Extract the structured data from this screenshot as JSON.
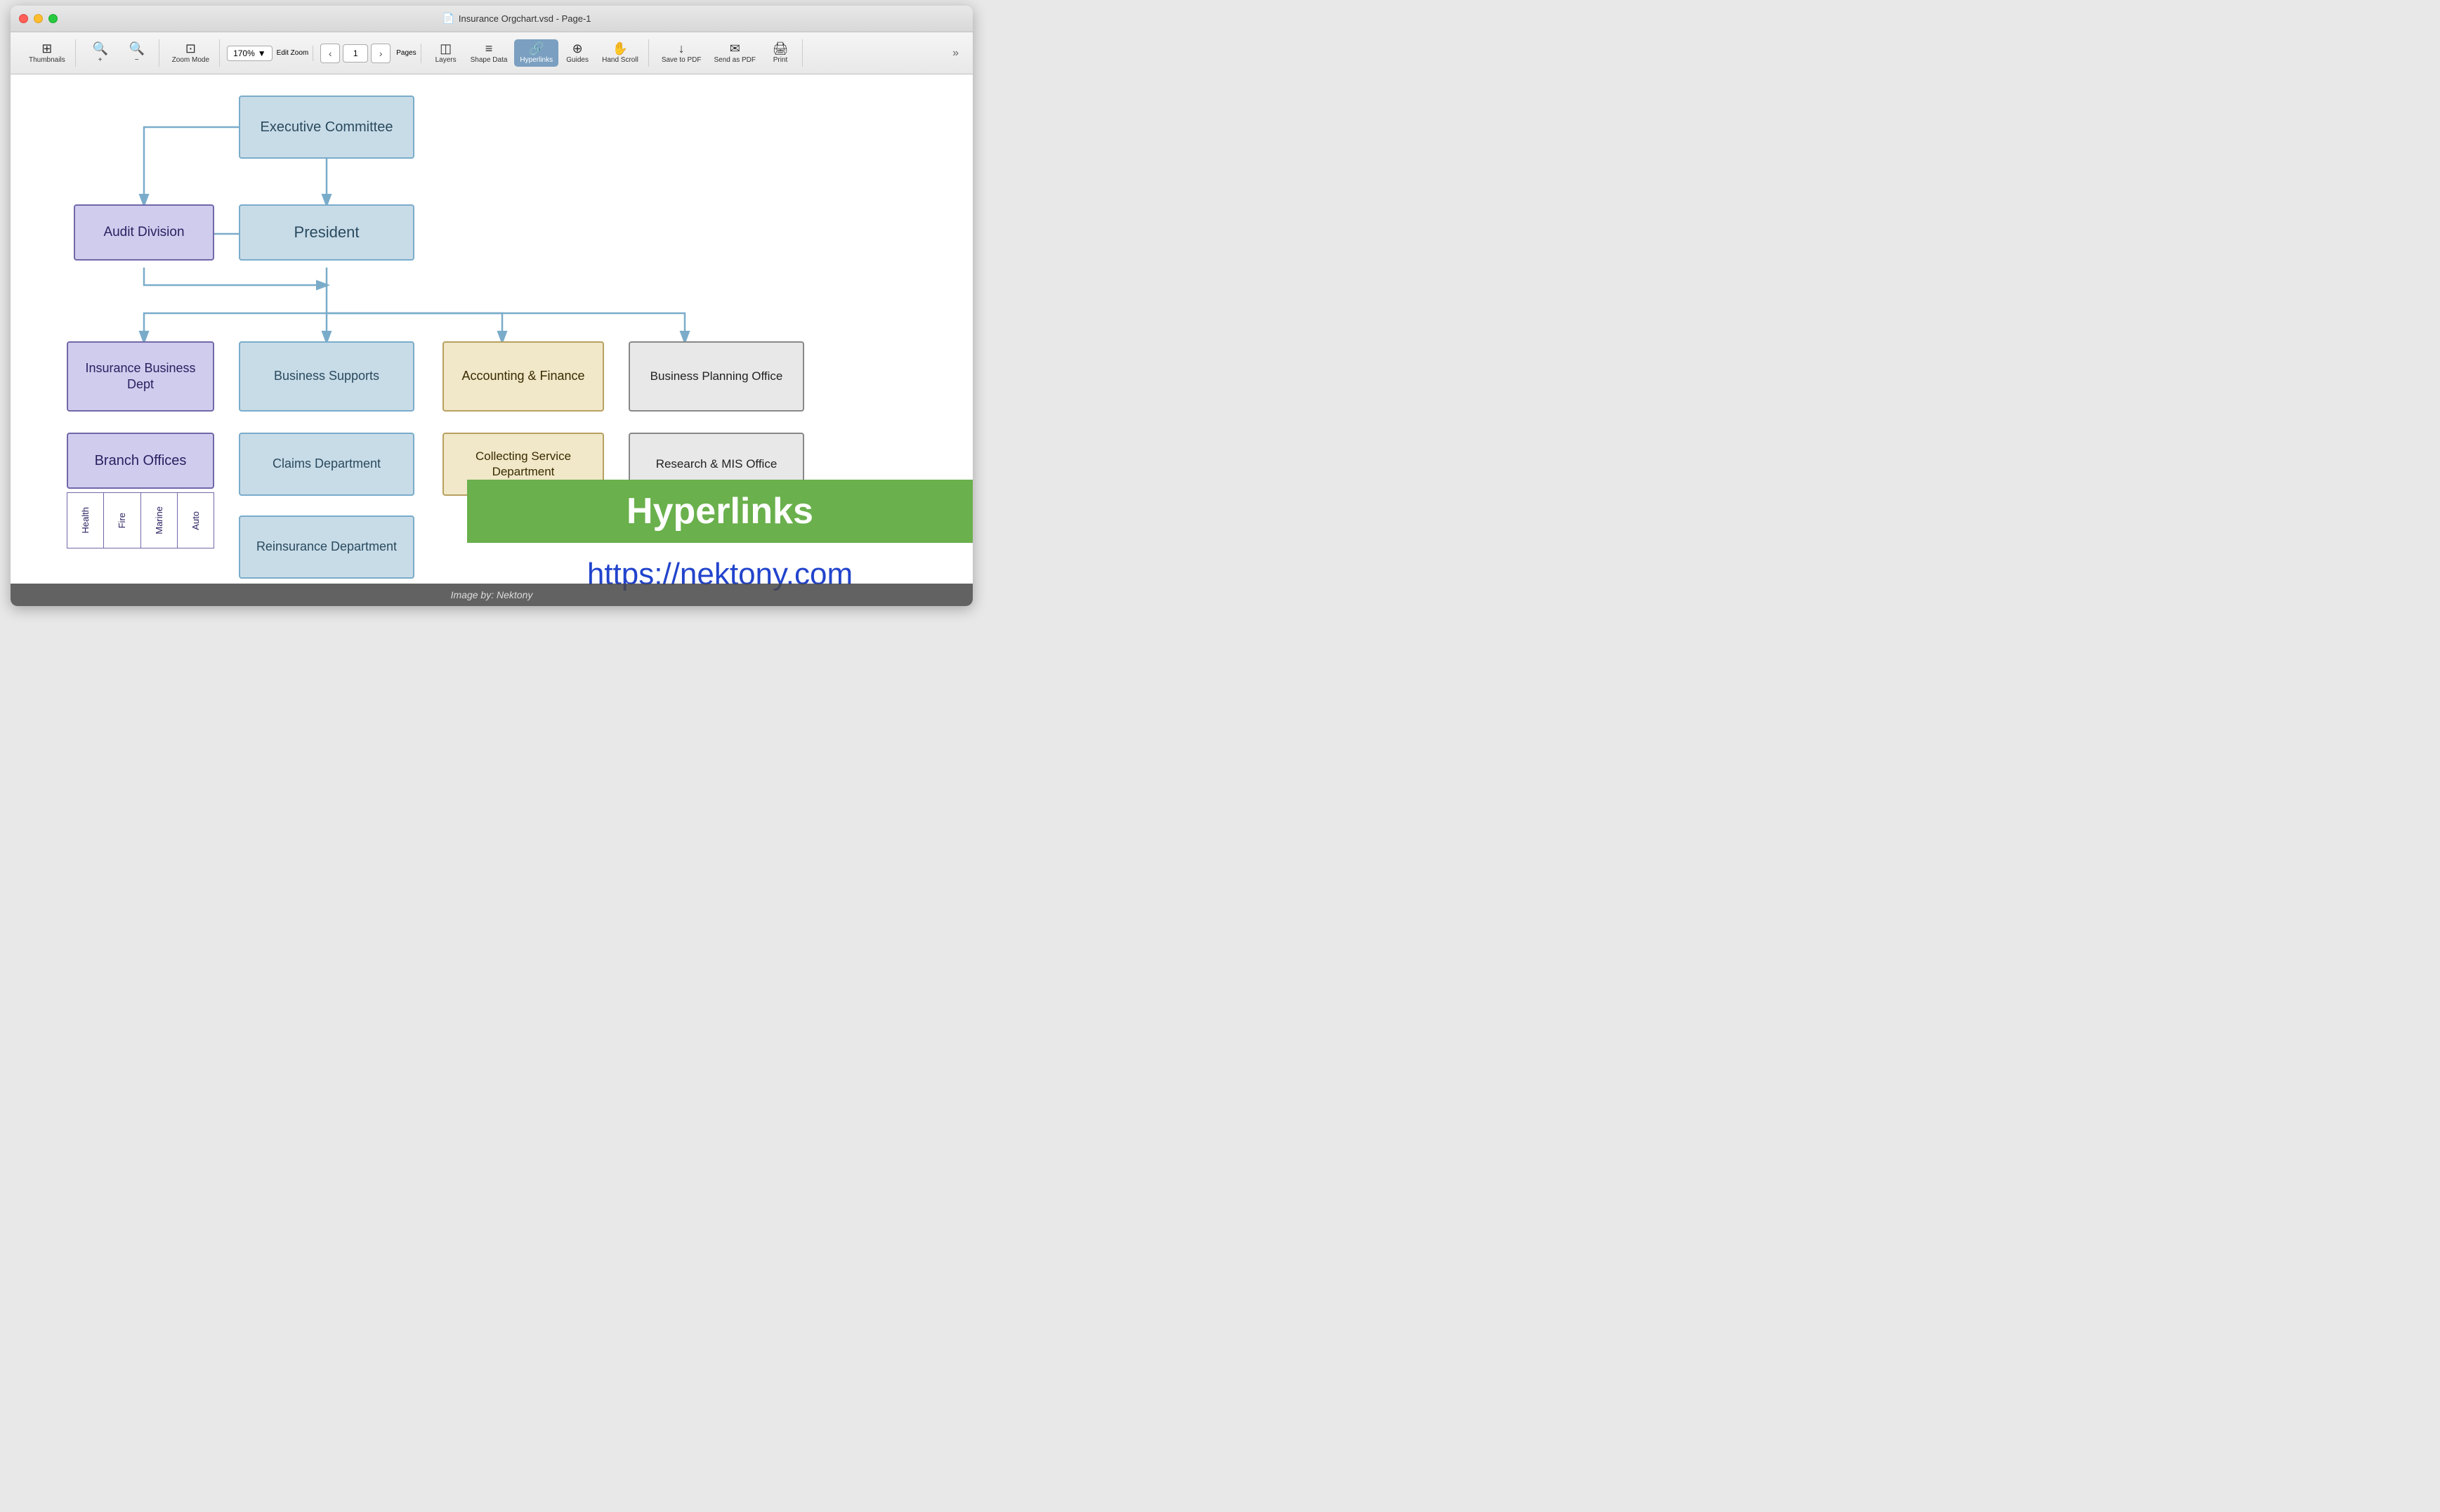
{
  "window": {
    "title": "Insurance Orgchart.vsd - Page-1"
  },
  "toolbar": {
    "thumbnails_label": "Thumbnails",
    "zoom_in_label": "Zoom",
    "zoom_mode_label": "Zoom Mode",
    "edit_zoom_label": "Edit Zoom",
    "zoom_value": "170%",
    "pages_label": "Pages",
    "page_num": "1",
    "layers_label": "Layers",
    "shape_data_label": "Shape Data",
    "hyperlinks_label": "Hyperlinks",
    "guides_label": "Guides",
    "hand_scroll_label": "Hand Scroll",
    "save_pdf_label": "Save to PDF",
    "send_pdf_label": "Send as PDF",
    "print_label": "Print"
  },
  "orgchart": {
    "executive_committee": "Executive Committee",
    "president": "President",
    "audit_division": "Audit Division",
    "insurance_business": "Insurance Business Dept",
    "business_supports": "Business Supports",
    "accounting_finance": "Accounting & Finance",
    "business_planning": "Business Planning Office",
    "branch_offices": "Branch Offices",
    "claims_dept": "Claims Department",
    "collecting_service": "Collecting Service Department",
    "research_mis": "Research & MIS Office",
    "reinsurance": "Reinsurance Department",
    "branch_subs": [
      "Health",
      "Fire",
      "Marine",
      "Auto"
    ]
  },
  "hyperlinks_overlay": {
    "title": "Hyperlinks",
    "url": "https://nektony.com"
  },
  "bottom_bar": {
    "text": "Image by: Nektony"
  }
}
